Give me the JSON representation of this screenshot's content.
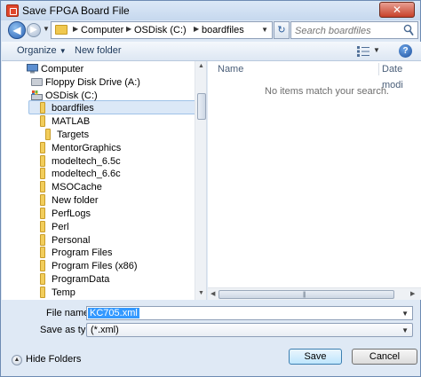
{
  "window": {
    "title": "Save FPGA Board File",
    "close_glyph": "✕"
  },
  "address": {
    "crumbs": [
      "Computer",
      "OSDisk (C:)",
      "boardfiles"
    ],
    "separator_glyph": "▶",
    "dropdown_glyph": "▼"
  },
  "search": {
    "placeholder": "Search boardfiles"
  },
  "toolbar": {
    "organize_label": "Organize",
    "organize_glyph": "▼",
    "new_folder_label": "New folder",
    "help_glyph": "?"
  },
  "tree": {
    "items": [
      {
        "label": "Computer",
        "icon": "computer-icon"
      },
      {
        "label": "Floppy Disk Drive (A:)",
        "icon": "floppy-drive-icon"
      },
      {
        "label": "OSDisk (C:)",
        "icon": "hard-drive-icon"
      },
      {
        "label": "boardfiles",
        "icon": "folder-icon",
        "selected": true
      },
      {
        "label": "MATLAB",
        "icon": "folder-icon"
      },
      {
        "label": "Targets",
        "icon": "folder-icon"
      },
      {
        "label": "MentorGraphics",
        "icon": "folder-icon"
      },
      {
        "label": "modeltech_6.5c",
        "icon": "folder-icon"
      },
      {
        "label": "modeltech_6.6c",
        "icon": "folder-icon"
      },
      {
        "label": "MSOCache",
        "icon": "folder-icon"
      },
      {
        "label": "New folder",
        "icon": "folder-icon"
      },
      {
        "label": "PerfLogs",
        "icon": "folder-icon"
      },
      {
        "label": "Perl",
        "icon": "folder-icon"
      },
      {
        "label": "Personal",
        "icon": "folder-icon"
      },
      {
        "label": "Program Files",
        "icon": "folder-icon"
      },
      {
        "label": "Program Files (x86)",
        "icon": "folder-icon"
      },
      {
        "label": "ProgramData",
        "icon": "folder-icon"
      },
      {
        "label": "Temp",
        "icon": "folder-icon"
      }
    ]
  },
  "filelist": {
    "columns": [
      "Name",
      "Date modi"
    ],
    "empty_message": "No items match your search."
  },
  "form": {
    "file_name_label": "File name:",
    "file_name_value": "KC705.xml",
    "save_type_label": "Save as type:",
    "save_type_value": "(*.xml)"
  },
  "footer": {
    "hide_folders_label": "Hide Folders",
    "save_label": "Save",
    "cancel_label": "Cancel"
  },
  "colors": {
    "accent": "#3399ff",
    "selected_row": "#dbe8f7",
    "frame": "#dfe9f5"
  }
}
